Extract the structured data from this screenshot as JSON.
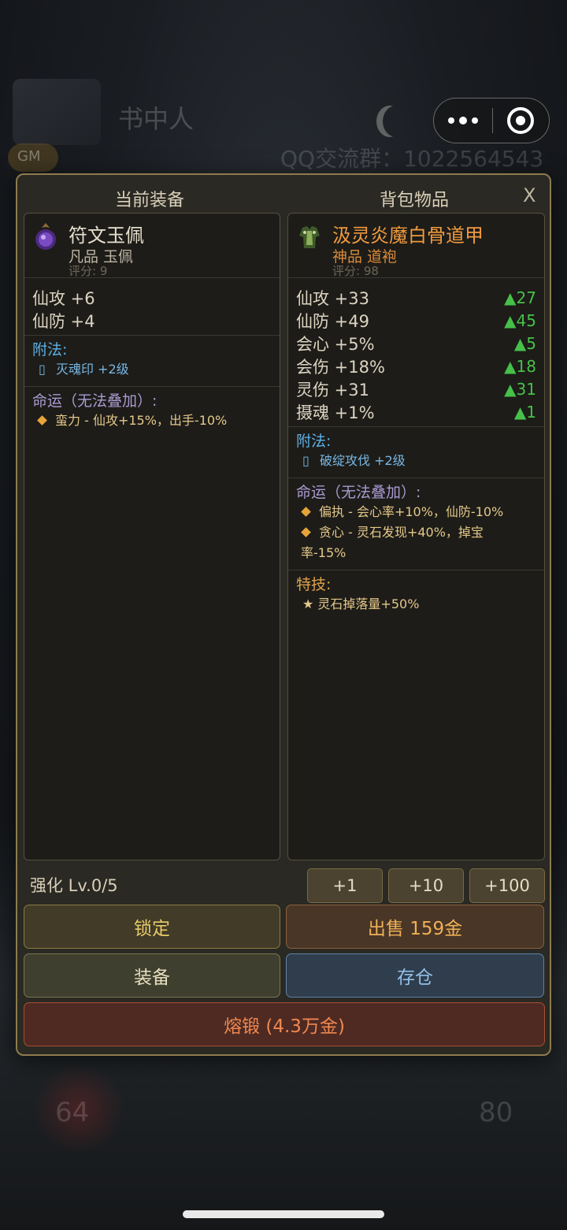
{
  "background": {
    "name": "书中人",
    "qq": "QQ交流群：1022564543",
    "badge": "GM",
    "left_number": "64",
    "right_number": "80"
  },
  "modal": {
    "header_left": "当前装备",
    "header_right": "背包物品",
    "close_label": "X",
    "current": {
      "name": "符文玉佩",
      "name_color": "#e7e0cf",
      "subtitle": "凡品 玉佩",
      "subtitle_color": "#bdb5a3",
      "score": "评分: 9",
      "icon": "purple-gem-icon",
      "stats": [
        {
          "label": "仙攻 +6"
        },
        {
          "label": "仙防 +4"
        }
      ],
      "enchant_title": "附法:",
      "enchants": [
        "灭魂印 +2级"
      ],
      "fate_title": "命运（无法叠加）:",
      "fates": [
        "蛮力 - 仙攻+15%，出手-10%"
      ]
    },
    "backpack": {
      "name": "汲灵炎魔白骨道甲",
      "name_color": "#f09a3e",
      "subtitle": "神品 道袍",
      "subtitle_color": "#d98a3a",
      "score": "评分: 98",
      "icon": "armor-icon",
      "stats": [
        {
          "label": "仙攻 +33",
          "diff": "▲27"
        },
        {
          "label": "仙防 +49",
          "diff": "▲45"
        },
        {
          "label": "会心 +5%",
          "diff": "▲5"
        },
        {
          "label": "会伤 +18%",
          "diff": "▲18"
        },
        {
          "label": "灵伤 +31",
          "diff": "▲31"
        },
        {
          "label": "摄魂 +1%",
          "diff": "▲1"
        }
      ],
      "enchant_title": "附法:",
      "enchants": [
        "破绽攻伐 +2级"
      ],
      "fate_title": "命运（无法叠加）:",
      "fates": [
        "偏执 - 会心率+10%，仙防-10%",
        "贪心 - 灵石发现+40%，掉宝",
        "率-15%"
      ],
      "skill_title": "特技:",
      "skills": [
        "★ 灵石掉落量+50%"
      ]
    },
    "enhance_label": "强化 Lv.0/5",
    "steps": [
      "+1",
      "+10",
      "+100"
    ],
    "buttons": {
      "lock": "锁定",
      "sell": "出售 159金",
      "equip": "装备",
      "store": "存仓",
      "forge": "熔锻 (4.3万金)"
    }
  }
}
